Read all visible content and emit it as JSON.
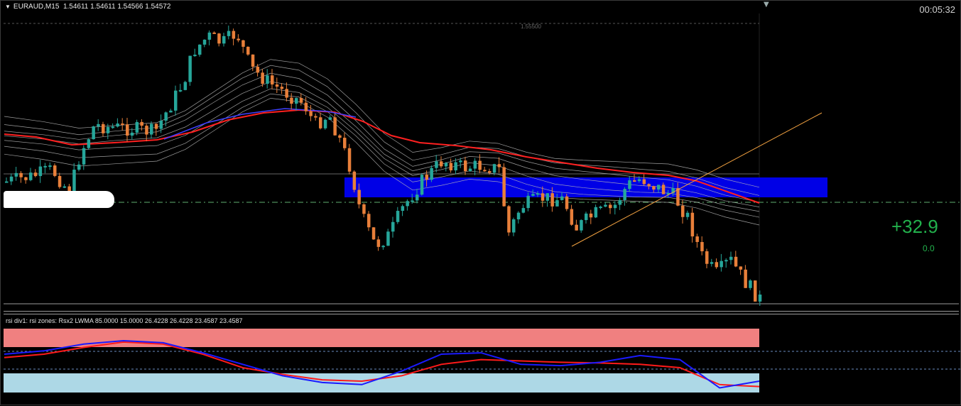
{
  "window": {
    "symbol": "EURAUD,M15",
    "ohlc": "1.54611 1.54611 1.54566 1.54572",
    "timer": "00:05:32"
  },
  "main_chart": {
    "level_label": "1.55500",
    "profit": "+32.9",
    "profit_sub": "0.0",
    "colors": {
      "bull_candle": "#26a69a",
      "bear_candle": "#e87f3a",
      "ma_red": "#ff2020",
      "ma_gray": "#b9b9b9",
      "zone_blue": "#0000e6",
      "trendline": "#f0a040",
      "profit": "#22b14c"
    },
    "demand_zone": {
      "label": "blue rectangle zone"
    }
  },
  "indicator": {
    "label": "rsi div1: rsi zones: Rsx2 LWMA 85.0000 15.0000 26.4228 26.4228 23.4587 23.4587",
    "colors": {
      "overbought_zone": "#f08080",
      "oversold_zone": "#add8e6",
      "line_red": "#ff1a1a",
      "line_blue": "#1a1aff"
    }
  },
  "chart_data": {
    "type": "candlestick",
    "instrument": "EURAUD",
    "timeframe": "M15",
    "candles_close_trend": [
      1.5445,
      1.5452,
      1.547,
      1.5488,
      1.548,
      1.5492,
      1.554,
      1.553,
      1.55,
      1.549,
      1.547,
      1.543,
      1.5405,
      1.543,
      1.5455,
      1.544,
      1.546,
      1.541,
      1.544,
      1.5445,
      1.543,
      1.545,
      1.5455,
      1.544,
      1.54,
      1.542,
      1.539,
      1.538
    ],
    "indicator_values": {
      "red_line": [
        55,
        60,
        70,
        78,
        75,
        60,
        40,
        30,
        22,
        20,
        28,
        45,
        52,
        50,
        48,
        47,
        45,
        40,
        15,
        12
      ],
      "blue_line": [
        60,
        65,
        75,
        80,
        77,
        62,
        45,
        28,
        18,
        15,
        35,
        60,
        62,
        45,
        43,
        48,
        58,
        52,
        10,
        20
      ]
    }
  }
}
